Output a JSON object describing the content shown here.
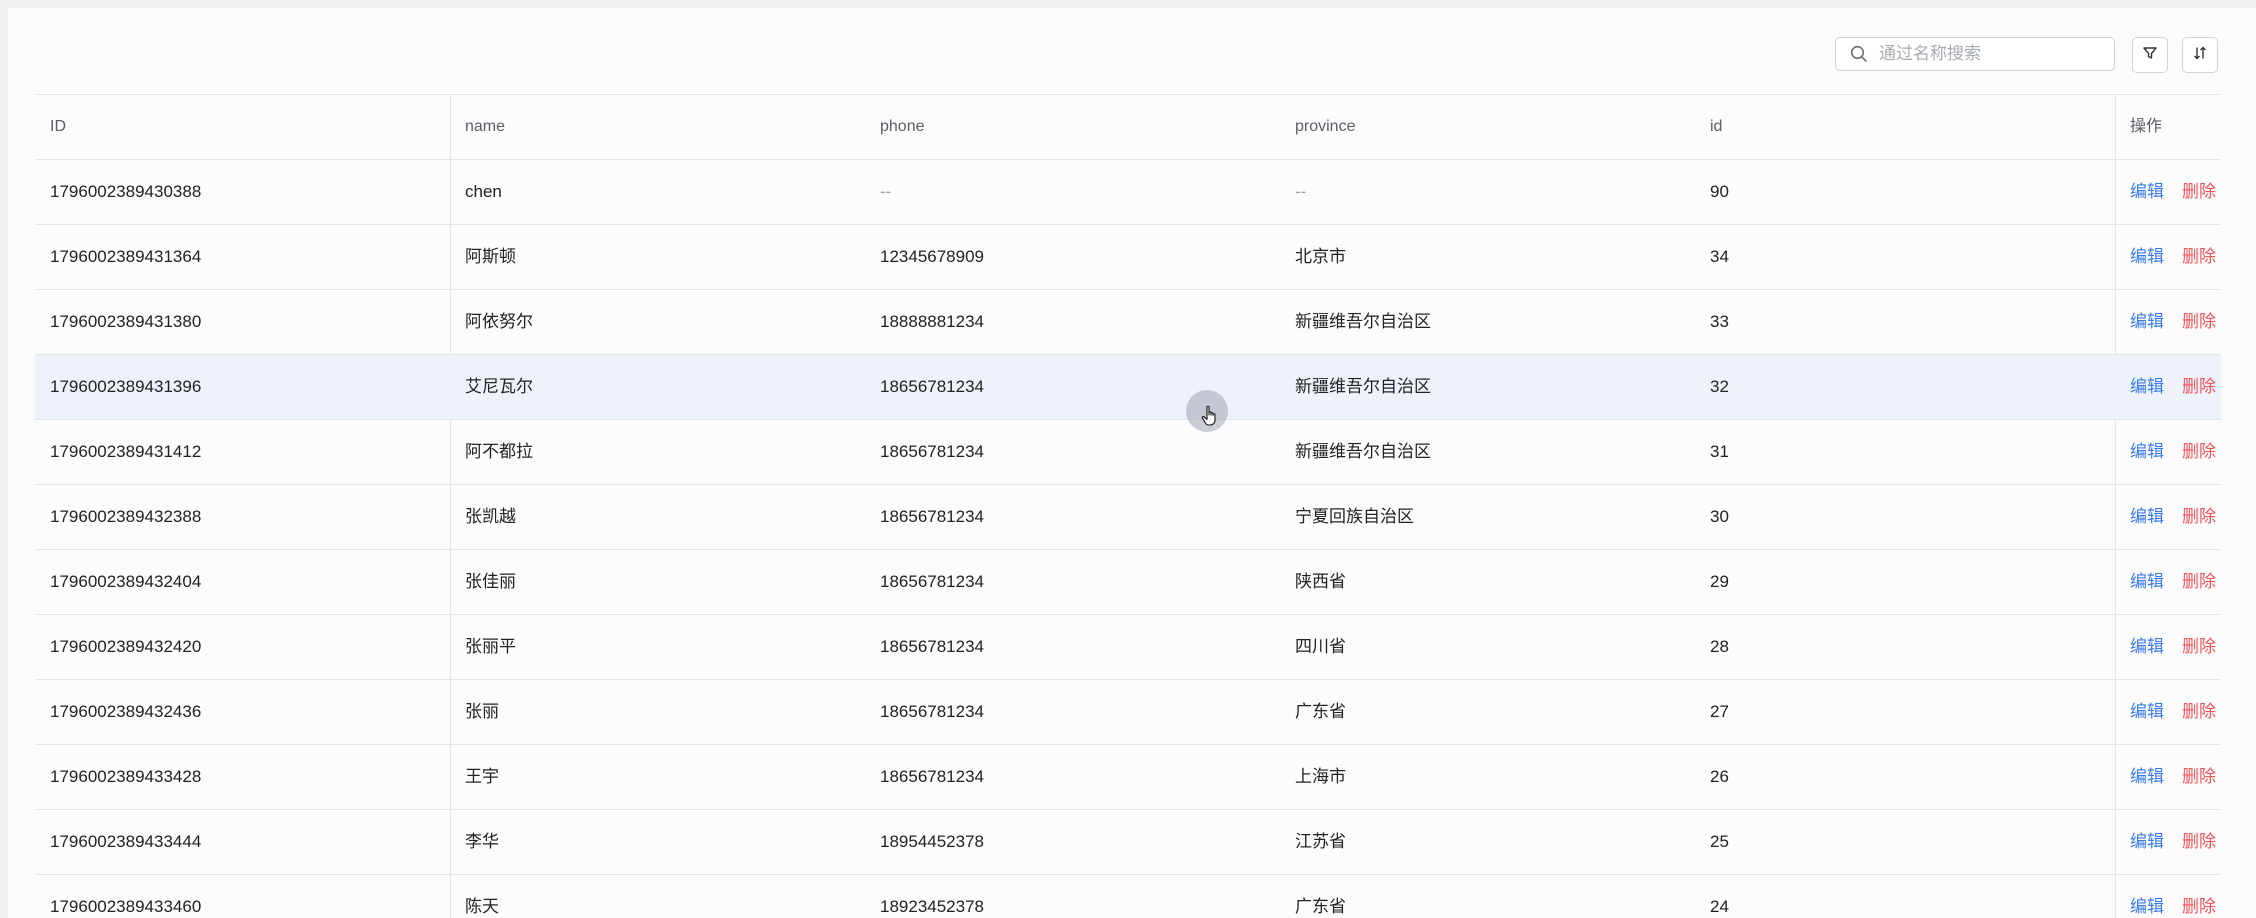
{
  "toolbar": {
    "search_placeholder": "通过名称搜索",
    "search_icon": "search-icon",
    "filter_icon": "filter-icon",
    "sort_icon": "sort-icon"
  },
  "table": {
    "columns": [
      "ID",
      "name",
      "phone",
      "province",
      "id",
      "操作"
    ],
    "actions": {
      "edit": "编辑",
      "delete": "删除"
    },
    "rows": [
      {
        "ID": "1796002389430388",
        "name": "chen",
        "phone": "--",
        "province": "--",
        "id": "90"
      },
      {
        "ID": "1796002389431364",
        "name": "阿斯顿",
        "phone": "12345678909",
        "province": "北京市",
        "id": "34"
      },
      {
        "ID": "1796002389431380",
        "name": "阿依努尔",
        "phone": "18888881234",
        "province": "新疆维吾尔自治区",
        "id": "33"
      },
      {
        "ID": "1796002389431396",
        "name": "艾尼瓦尔",
        "phone": "18656781234",
        "province": "新疆维吾尔自治区",
        "id": "32"
      },
      {
        "ID": "1796002389431412",
        "name": "阿不都拉",
        "phone": "18656781234",
        "province": "新疆维吾尔自治区",
        "id": "31"
      },
      {
        "ID": "1796002389432388",
        "name": "张凯越",
        "phone": "18656781234",
        "province": "宁夏回族自治区",
        "id": "30"
      },
      {
        "ID": "1796002389432404",
        "name": "张佳丽",
        "phone": "18656781234",
        "province": "陕西省",
        "id": "29"
      },
      {
        "ID": "1796002389432420",
        "name": "张丽平",
        "phone": "18656781234",
        "province": "四川省",
        "id": "28"
      },
      {
        "ID": "1796002389432436",
        "name": "张丽",
        "phone": "18656781234",
        "province": "广东省",
        "id": "27"
      },
      {
        "ID": "1796002389433428",
        "name": "王宇",
        "phone": "18656781234",
        "province": "上海市",
        "id": "26"
      },
      {
        "ID": "1796002389433444",
        "name": "李华",
        "phone": "18954452378",
        "province": "江苏省",
        "id": "25"
      },
      {
        "ID": "1796002389433460",
        "name": "陈天",
        "phone": "18923452378",
        "province": "广东省",
        "id": "24"
      }
    ]
  },
  "colors": {
    "edit_link": "#3a7bf0",
    "delete_link": "#f0565a",
    "hover_row": "#eef2fb"
  }
}
